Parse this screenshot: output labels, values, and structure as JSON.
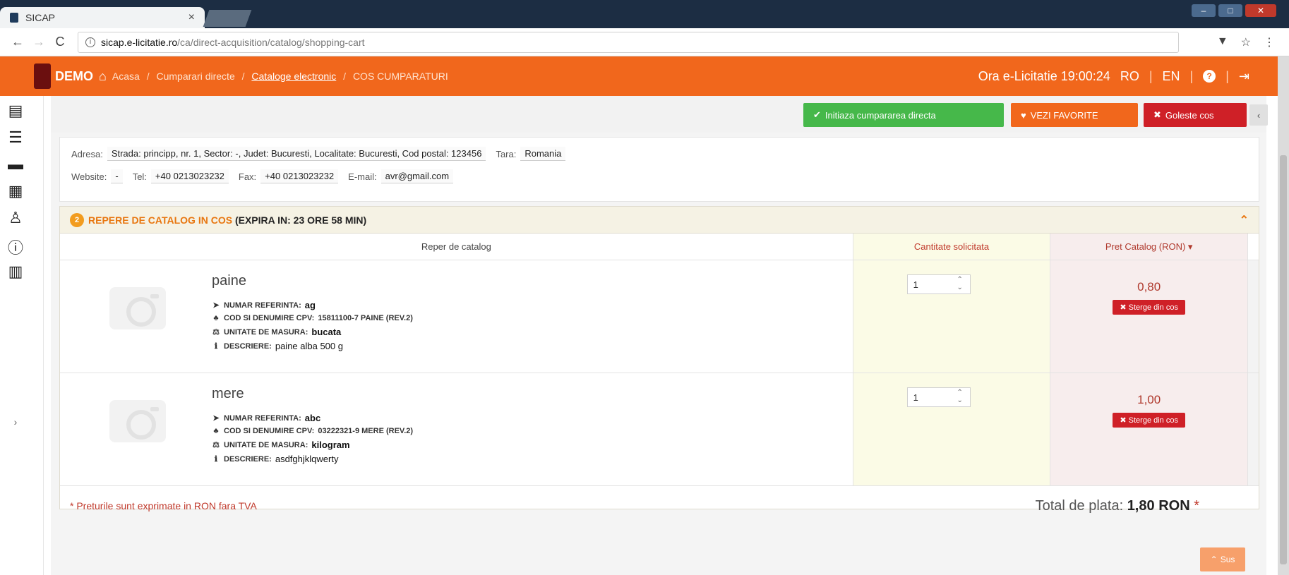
{
  "browser": {
    "tab_title": "SICAP",
    "tab_close": "×",
    "url_host": "sicap.e-licitatie.ro",
    "url_path": "/ca/direct-acquisition/catalog/shopping-cart",
    "nav_back": "←",
    "nav_forward": "→",
    "nav_reload": "C",
    "info_glyph": "i",
    "icon_menu": "⋮",
    "icon_star": "☆",
    "icon_ext": "▼"
  },
  "header": {
    "brand": "DEMO",
    "home_glyph": "⌂",
    "breadcrumbs": [
      "Acasa",
      "Cumparari directe",
      "Cataloge electronic",
      "COS CUMPARATURI"
    ],
    "sep": "/",
    "clock_label": "Ora e-Licitatie",
    "clock_value": "19:00:24",
    "lang_ro": "RO",
    "lang_en": "EN",
    "help_glyph": "?",
    "logout_glyph": "⇥",
    "pipe": "|"
  },
  "rail": {
    "expand_glyph": "›"
  },
  "actions": {
    "initiate_label": "Initiaza cumpararea directa",
    "initiate_glyph": "✔",
    "favorites_label": "VEZI FAVORITE",
    "favorites_glyph": "♥",
    "empty_label": "Goleste cos",
    "empty_glyph": "✖",
    "collapse_glyph": "‹"
  },
  "address": {
    "adresa_label": "Adresa:",
    "adresa_value": "Strada: principp, nr. 1, Sector: -, Judet: Bucuresti, Localitate: Bucuresti, Cod postal: 123456",
    "tara_label": "Tara:",
    "tara_value": "Romania",
    "website_label": "Website:",
    "website_value": "-",
    "tel_label": "Tel:",
    "tel_value": "+40 0213023232",
    "fax_label": "Fax:",
    "fax_value": "+40 0213023232",
    "email_label": "E-mail:",
    "email_value": "avr@gmail.com"
  },
  "cart": {
    "badge": "2",
    "title": "REPERE DE CATALOG IN COS",
    "expira_prefix": "(EXPIRA IN:",
    "hours": "23",
    "hours_unit": "ORE",
    "mins": "58",
    "mins_unit": "MIN)",
    "chev": "⌃",
    "col_item": "Reper de catalog",
    "col_qty": "Cantitate solicitata",
    "col_price": "Pret Catalog (RON) ▾",
    "ref_label": "NUMAR REFERINTA:",
    "cpv_label": "COD SI DENUMIRE CPV:",
    "um_label": "UNITATE DE MASURA:",
    "desc_label": "DESCRIERE:",
    "delete_label": "Sterge din cos",
    "delete_glyph": "✖",
    "spin_up": "⌃",
    "spin_down": "⌄",
    "items": [
      {
        "name": "paine",
        "ref": "ag",
        "cpv": "15811100-7 PAINE (REV.2)",
        "um": "bucata",
        "desc": "paine alba 500 g",
        "qty": "1",
        "price": "0,80"
      },
      {
        "name": "mere",
        "ref": "abc",
        "cpv": "03222321-9 MERE (REV.2)",
        "um": "kilogram",
        "desc": "asdfghjklqwerty",
        "qty": "1",
        "price": "1,00"
      }
    ],
    "note": "* Preturile sunt exprimate in RON fara TVA",
    "total_label": "Total de plata:",
    "total_value": "1,80",
    "total_currency": "RON",
    "total_star": "*"
  },
  "scrolltop": {
    "label": "Sus",
    "glyph": "⌃"
  }
}
